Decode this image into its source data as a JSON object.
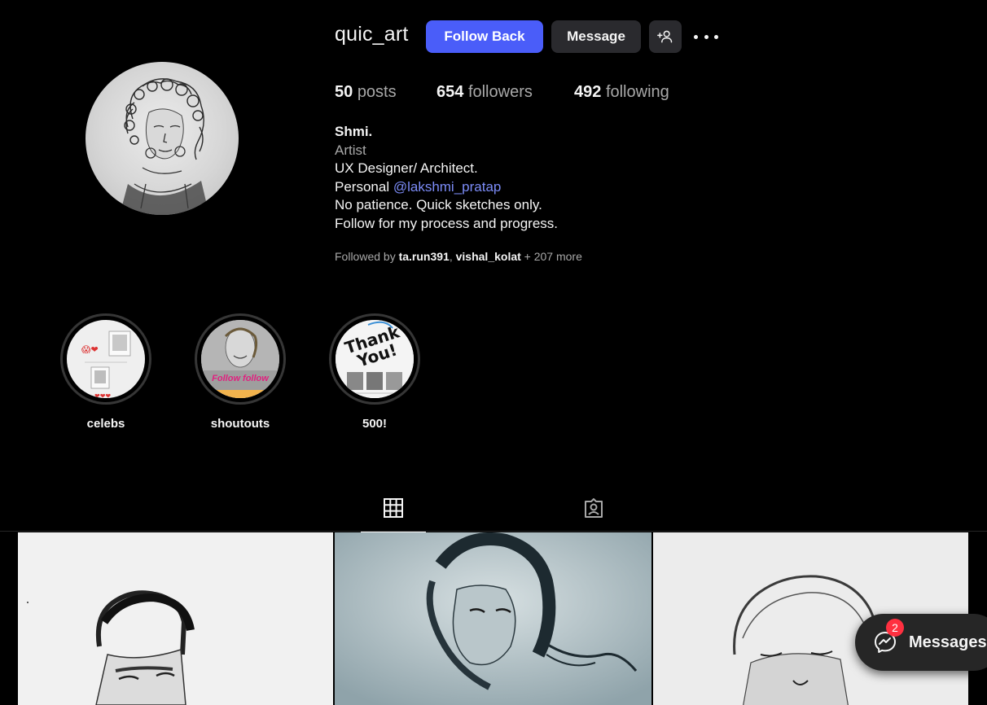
{
  "profile": {
    "username": "quic_art",
    "follow_back_label": "Follow Back",
    "message_label": "Message"
  },
  "stats": {
    "posts_count": "50",
    "posts_label": "posts",
    "followers_count": "654",
    "followers_label": "followers",
    "following_count": "492",
    "following_label": "following"
  },
  "bio": {
    "name": "Shmi.",
    "category": "Artist",
    "line1": "UX Designer/ Architect.",
    "line2_prefix": "Personal ",
    "line2_mention": "@lakshmi_pratap",
    "line3": "No patience. Quick sketches only.",
    "line4": "Follow for my process and progress."
  },
  "followed_by": {
    "prefix": "Followed by ",
    "user1": "ta.run391",
    "separator": ", ",
    "user2": "vishal_kolat",
    "suffix": " + 207 more"
  },
  "highlights": [
    {
      "label": "celebs"
    },
    {
      "label": "shoutouts"
    },
    {
      "label": "500!"
    }
  ],
  "highlight_art": {
    "shoutouts_text": "Follow follow",
    "thankyou_line1": "Thank",
    "thankyou_line2": "You!"
  },
  "tabs": {
    "posts_icon": "grid-icon",
    "tagged_icon": "tagged-icon"
  },
  "messages": {
    "label": "Messages",
    "badge": "2"
  },
  "colors": {
    "accent": "#4a5df9",
    "mention": "#7c8cf8",
    "badge": "#ff3040",
    "background": "#000000"
  }
}
